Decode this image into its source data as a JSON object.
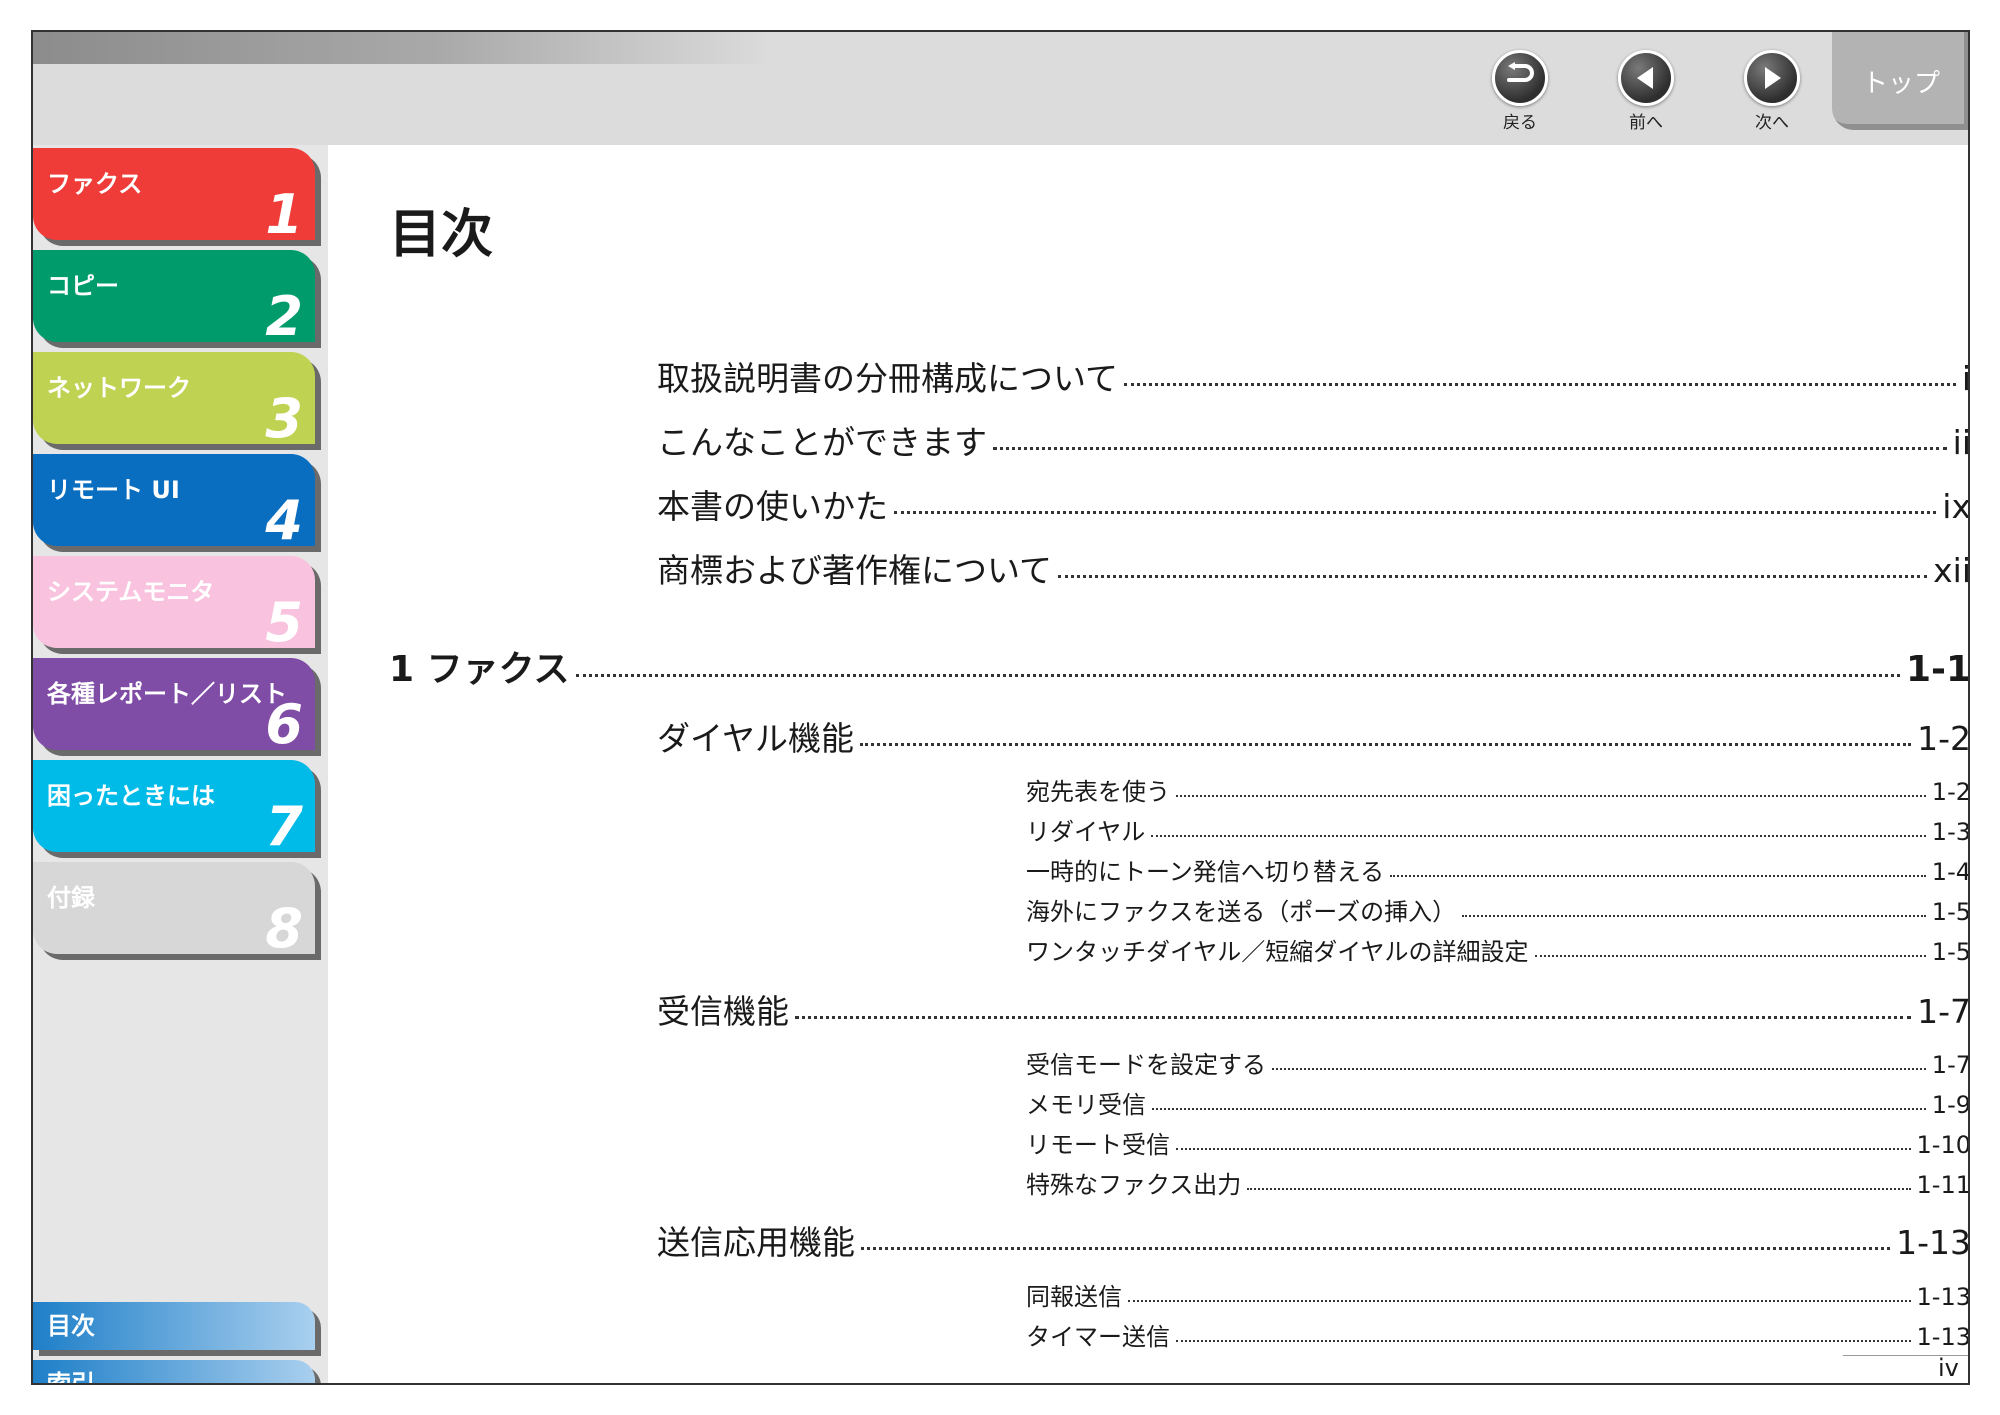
{
  "header": {
    "back_label": "戻る",
    "prev_label": "前へ",
    "next_label": "次へ",
    "top_label": "トップ",
    "back_icon": "return-arrow-icon",
    "prev_icon": "left-triangle-icon",
    "next_icon": "right-triangle-icon"
  },
  "sidebar": {
    "chapters": [
      {
        "label": "ファクス",
        "num": "1",
        "color": "#ef3c38"
      },
      {
        "label": "コピー",
        "num": "2",
        "color": "#009b6b"
      },
      {
        "label": "ネットワーク",
        "num": "3",
        "color": "#bfd252"
      },
      {
        "label": "リモート UI",
        "num": "4",
        "color": "#0a6ec0"
      },
      {
        "label": "システムモニタ",
        "num": "5",
        "color": "#f9c2de"
      },
      {
        "label": "各種レポート／リスト",
        "num": "6",
        "color": "#7f4ca6"
      },
      {
        "label": "困ったときには",
        "num": "7",
        "color": "#00bbe8"
      },
      {
        "label": "付録",
        "num": "8",
        "color": "#d7d7d7"
      }
    ],
    "contents_label": "目次",
    "index_label": "索引"
  },
  "page": {
    "title": "目次",
    "page_number": "iv"
  },
  "toc": [
    {
      "text": "取扱説明書の分冊構成について",
      "page": "i",
      "level": 1
    },
    {
      "text": "こんなことができます",
      "page": "ii",
      "level": 1
    },
    {
      "text": "本書の使いかた",
      "page": "ix",
      "level": 1
    },
    {
      "text": "商標および著作権について",
      "page": "xii",
      "level": 1
    },
    {
      "text": "1 ファクス",
      "page": "1-1",
      "level": 0
    },
    {
      "text": "ダイヤル機能",
      "page": "1-2",
      "level": 1
    },
    {
      "text": "宛先表を使う",
      "page": "1-2",
      "level": 2
    },
    {
      "text": "リダイヤル",
      "page": "1-3",
      "level": 2
    },
    {
      "text": "一時的にトーン発信へ切り替える",
      "page": "1-4",
      "level": 2
    },
    {
      "text": "海外にファクスを送る（ポーズの挿入）",
      "page": "1-5",
      "level": 2
    },
    {
      "text": "ワンタッチダイヤル／短縮ダイヤルの詳細設定",
      "page": "1-5",
      "level": 2
    },
    {
      "text": "受信機能",
      "page": "1-7",
      "level": 1
    },
    {
      "text": "受信モードを設定する",
      "page": "1-7",
      "level": 2
    },
    {
      "text": "メモリ受信",
      "page": "1-9",
      "level": 2
    },
    {
      "text": "リモート受信",
      "page": "1-10",
      "level": 2
    },
    {
      "text": "特殊なファクス出力",
      "page": "1-11",
      "level": 2
    },
    {
      "text": "送信応用機能",
      "page": "1-13",
      "level": 1
    },
    {
      "text": "同報送信",
      "page": "1-13",
      "level": 2
    },
    {
      "text": "タイマー送信",
      "page": "1-13",
      "level": 2
    }
  ]
}
